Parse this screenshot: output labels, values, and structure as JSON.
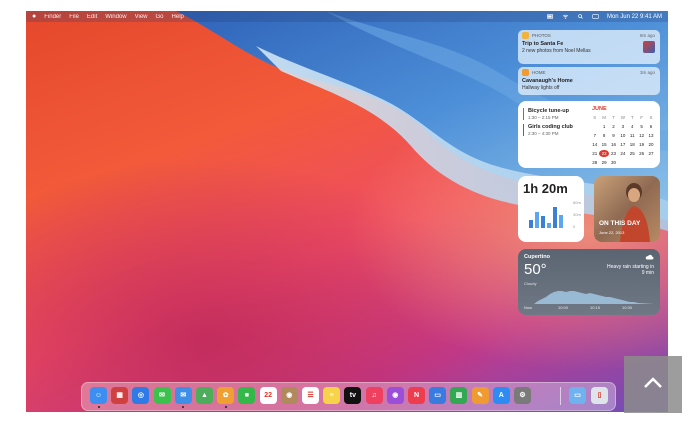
{
  "menubar": {
    "items": [
      "Finder",
      "File",
      "Edit",
      "Window",
      "View",
      "Go",
      "Help"
    ],
    "clock": "Mon Jun 22  9:41 AM"
  },
  "notifications": [
    {
      "app": "PHOTOS",
      "time": "8m ago",
      "title": "Trip to Santa Fe",
      "body": "2 new photos from Noel Mellas",
      "color": "#f2b33d"
    },
    {
      "app": "HOME",
      "time": "3m ago",
      "title": "Cavanaugh's Home",
      "body": "Hallway lights off",
      "color": "#f29b2f"
    }
  ],
  "calendar": {
    "events": [
      {
        "title": "Bicycle tune-up",
        "time": "1:30 – 2:15 PM",
        "color": "#3b7de0"
      },
      {
        "title": "Girls coding club",
        "time": "2:30 – 4:30 PM",
        "color": "#e0352b"
      }
    ],
    "month": "JUNE",
    "weekdays": [
      "S",
      "M",
      "T",
      "W",
      "T",
      "F",
      "S"
    ],
    "days": [
      "",
      "1",
      "2",
      "3",
      "4",
      "5",
      "6",
      "7",
      "8",
      "9",
      "10",
      "11",
      "12",
      "13",
      "14",
      "15",
      "16",
      "17",
      "18",
      "19",
      "20",
      "21",
      "22",
      "23",
      "24",
      "25",
      "26",
      "27",
      "28",
      "29",
      "30",
      "",
      "",
      "",
      ""
    ],
    "today": "22"
  },
  "screen_time": {
    "value": "1h 20m",
    "bars": [
      0.3,
      0.6,
      0.45,
      0.2,
      0.8,
      0.5
    ],
    "labels": [
      "60m",
      "30m",
      "0"
    ]
  },
  "photo_widget": {
    "title": "ON THIS DAY",
    "date": "June 22, 2013"
  },
  "weather": {
    "city": "Cupertino",
    "temp": "50°",
    "condition": "Cloudy",
    "description": "Heavy rain starting in 9 min",
    "ticks": [
      "Now",
      "10:00",
      "10:15",
      "10:30"
    ]
  },
  "dock": {
    "apps": [
      {
        "name": "finder",
        "color": "#3c8ef0",
        "glyph": "☺",
        "running": true
      },
      {
        "name": "launchpad",
        "color": "#d04040",
        "glyph": "▦",
        "running": false
      },
      {
        "name": "safari",
        "color": "#2e7ae6",
        "glyph": "◎",
        "running": false
      },
      {
        "name": "messages",
        "color": "#3ac24c",
        "glyph": "✉",
        "running": false
      },
      {
        "name": "mail",
        "color": "#3f8fe8",
        "glyph": "✉",
        "running": true
      },
      {
        "name": "maps",
        "color": "#4cae5a",
        "glyph": "▲",
        "running": false
      },
      {
        "name": "photos",
        "color": "#f0a030",
        "glyph": "✿",
        "running": true
      },
      {
        "name": "facetime",
        "color": "#35b84a",
        "glyph": "■",
        "running": false
      },
      {
        "name": "calendar",
        "color": "#ffffff",
        "glyph": "22",
        "running": false
      },
      {
        "name": "contacts",
        "color": "#b08a5c",
        "glyph": "◉",
        "running": false
      },
      {
        "name": "reminders",
        "color": "#ffffff",
        "glyph": "☰",
        "running": false
      },
      {
        "name": "notes",
        "color": "#f6d349",
        "glyph": "≡",
        "running": false
      },
      {
        "name": "tv",
        "color": "#111111",
        "glyph": "tv",
        "running": false
      },
      {
        "name": "music",
        "color": "#f04060",
        "glyph": "♫",
        "running": false
      },
      {
        "name": "podcasts",
        "color": "#9b4fd9",
        "glyph": "◉",
        "running": false
      },
      {
        "name": "news",
        "color": "#ee3d4f",
        "glyph": "N",
        "running": false
      },
      {
        "name": "keynote",
        "color": "#3a7be0",
        "glyph": "▭",
        "running": false
      },
      {
        "name": "numbers",
        "color": "#33a852",
        "glyph": "▥",
        "running": false
      },
      {
        "name": "pages",
        "color": "#f09a32",
        "glyph": "✎",
        "running": false
      },
      {
        "name": "app-store",
        "color": "#2e8bf2",
        "glyph": "A",
        "running": false
      },
      {
        "name": "system-preferences",
        "color": "#7a7a7a",
        "glyph": "⚙",
        "running": false
      },
      {
        "name": "downloads-folder",
        "color": "#6fb2ee",
        "glyph": "▭",
        "running": false
      },
      {
        "name": "trash",
        "color": "#dfe4ea",
        "glyph": "▯",
        "running": false
      }
    ]
  }
}
